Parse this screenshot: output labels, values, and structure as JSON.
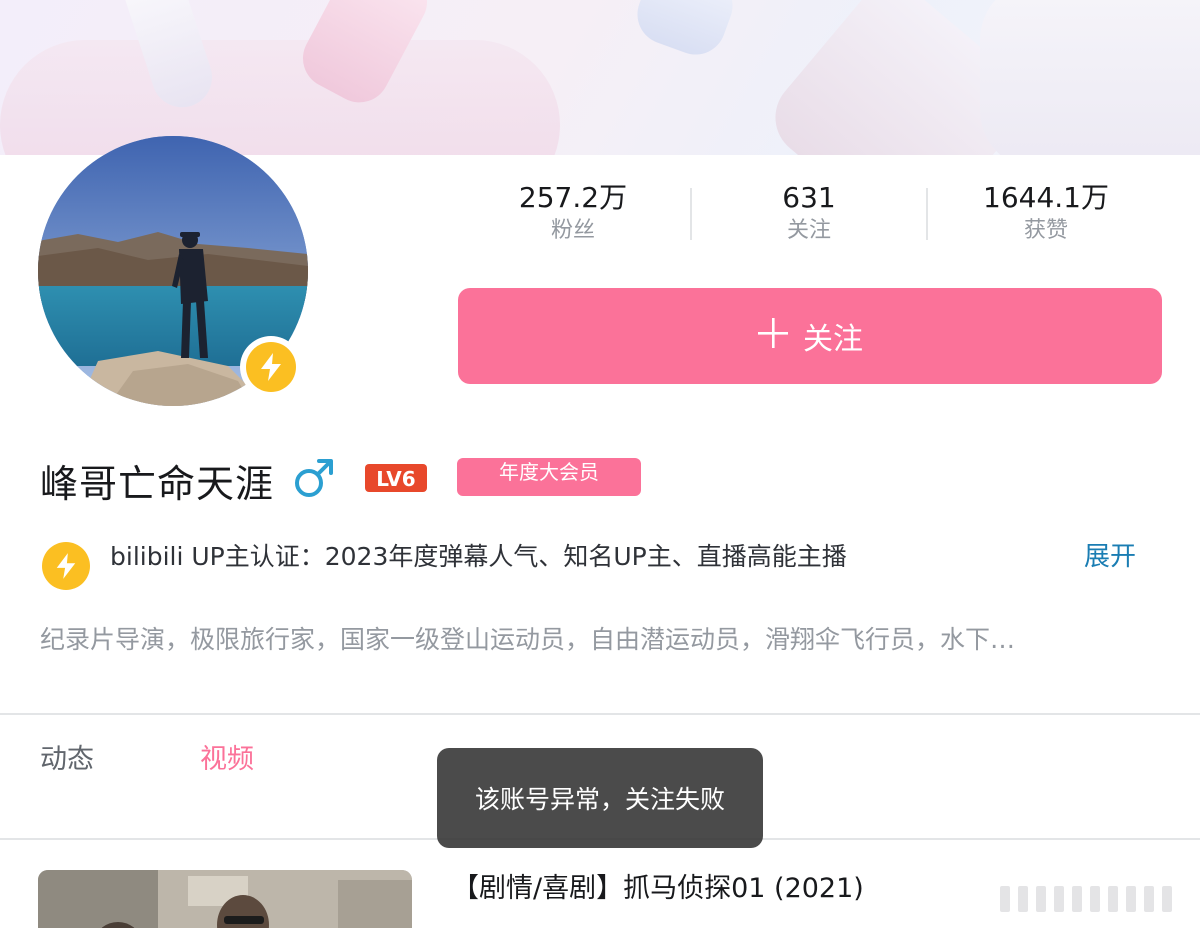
{
  "profile": {
    "username": "峰哥亡命天涯",
    "gender_symbol": "♂",
    "level": "LV6",
    "vip_label": "年度大会员"
  },
  "stats": [
    {
      "value": "257.2万",
      "label": "粉丝"
    },
    {
      "value": "631",
      "label": "关注"
    },
    {
      "value": "1644.1万",
      "label": "获赞"
    }
  ],
  "follow_button": {
    "icon": "plus-icon",
    "label": "关注"
  },
  "certification": {
    "icon": "lightning-badge-icon",
    "text": "bilibili UP主认证：2023年度弹幕人气、知名UP主、直播高能主播",
    "expand_label": "展开"
  },
  "bio": "纪录片导演，极限旅行家，国家一级登山运动员，自由潜运动员，滑翔伞飞行员，水下…",
  "tabs": [
    {
      "label": "动态",
      "active": false
    },
    {
      "label": "视频",
      "active": true
    }
  ],
  "toast": "该账号异常，关注失败",
  "video": {
    "title": "【剧情/喜剧】抓马侦探01 (2021)"
  },
  "colors": {
    "accent_pink": "#fb7299",
    "link_blue": "#1a7db3",
    "badge_yellow": "#fbbf22",
    "level_red": "#e8482b"
  }
}
